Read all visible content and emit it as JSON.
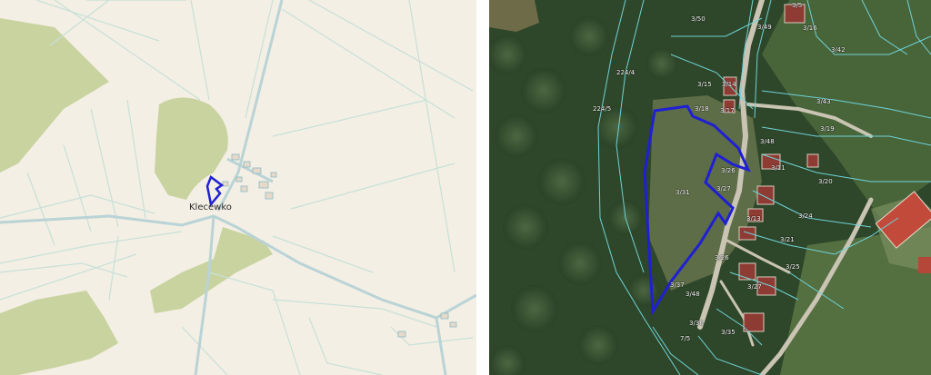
{
  "left_map": {
    "village_label": "Klecewko",
    "colors": {
      "background": "#f3efe4",
      "forest": "#c9d3a0",
      "road": "#b9d3d6",
      "field_boundary": "#c8e0d8",
      "parcel_outline": "#1f1fd4"
    }
  },
  "right_map": {
    "colors": {
      "parcel_outline": "#1f1fd4",
      "cadastral_lines": "#6fd3d8"
    },
    "plot_labels": [
      {
        "id": "3-50",
        "text": "3/50"
      },
      {
        "id": "3-49",
        "text": "3/49"
      },
      {
        "id": "3-51-top",
        "text": "3/5"
      },
      {
        "id": "3-16",
        "text": "3/16"
      },
      {
        "id": "3-42",
        "text": "3/42"
      },
      {
        "id": "224-4",
        "text": "224/4"
      },
      {
        "id": "3-15",
        "text": "3/15"
      },
      {
        "id": "3-14",
        "text": "3/14"
      },
      {
        "id": "3-18",
        "text": "3/18"
      },
      {
        "id": "3-17",
        "text": "3/17"
      },
      {
        "id": "3-43",
        "text": "3/43"
      },
      {
        "id": "224-5",
        "text": "224/5"
      },
      {
        "id": "3-19",
        "text": "3/19"
      },
      {
        "id": "3-48",
        "text": "3/48"
      },
      {
        "id": "3-11",
        "text": "3/11"
      },
      {
        "id": "3-26-upper",
        "text": "3/26"
      },
      {
        "id": "3-20",
        "text": "3/20"
      },
      {
        "id": "3-27-upper",
        "text": "3/27"
      },
      {
        "id": "3-31",
        "text": "3/31"
      },
      {
        "id": "3-13",
        "text": "3/13"
      },
      {
        "id": "3-24",
        "text": "3/24"
      },
      {
        "id": "3-21",
        "text": "3/21"
      },
      {
        "id": "3-26-lower",
        "text": "3/26"
      },
      {
        "id": "3-25",
        "text": "3/25"
      },
      {
        "id": "3-37",
        "text": "3/37"
      },
      {
        "id": "3-27-lower",
        "text": "3/27"
      },
      {
        "id": "3-48-lower",
        "text": "3/48"
      },
      {
        "id": "3-36",
        "text": "3/36"
      },
      {
        "id": "3-35",
        "text": "3/35"
      },
      {
        "id": "7-5",
        "text": "7/5"
      }
    ]
  }
}
